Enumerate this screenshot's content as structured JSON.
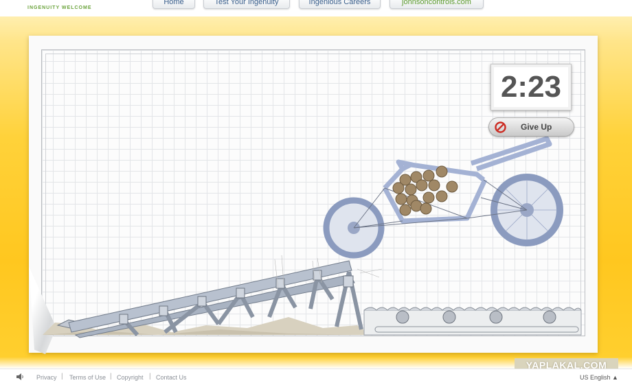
{
  "header": {
    "brand": "INGENUITY WELCOME",
    "nav": [
      {
        "label": "Home"
      },
      {
        "label": "Test Your Ingenuity"
      },
      {
        "label": "Ingenious Careers"
      },
      {
        "label": "johnsoncontrols.com"
      }
    ]
  },
  "game": {
    "timer": "2:23",
    "give_up_label": "Give Up"
  },
  "watermark": "YAPLAKAL.COM",
  "footer": {
    "links": [
      "Privacy",
      "Terms of Use",
      "Copyright",
      "Contact Us"
    ],
    "separator": "|",
    "language": "US English ▲"
  },
  "icons": {
    "speaker": "speaker-icon",
    "give_up": "no-entry-icon"
  },
  "colors": {
    "background_yellow": "#ffc71f",
    "wheel": "#8b9bbf",
    "frame": "#a4b2d4",
    "nav_text": "#3a5f8c",
    "nav_green": "#5d9b2f"
  }
}
